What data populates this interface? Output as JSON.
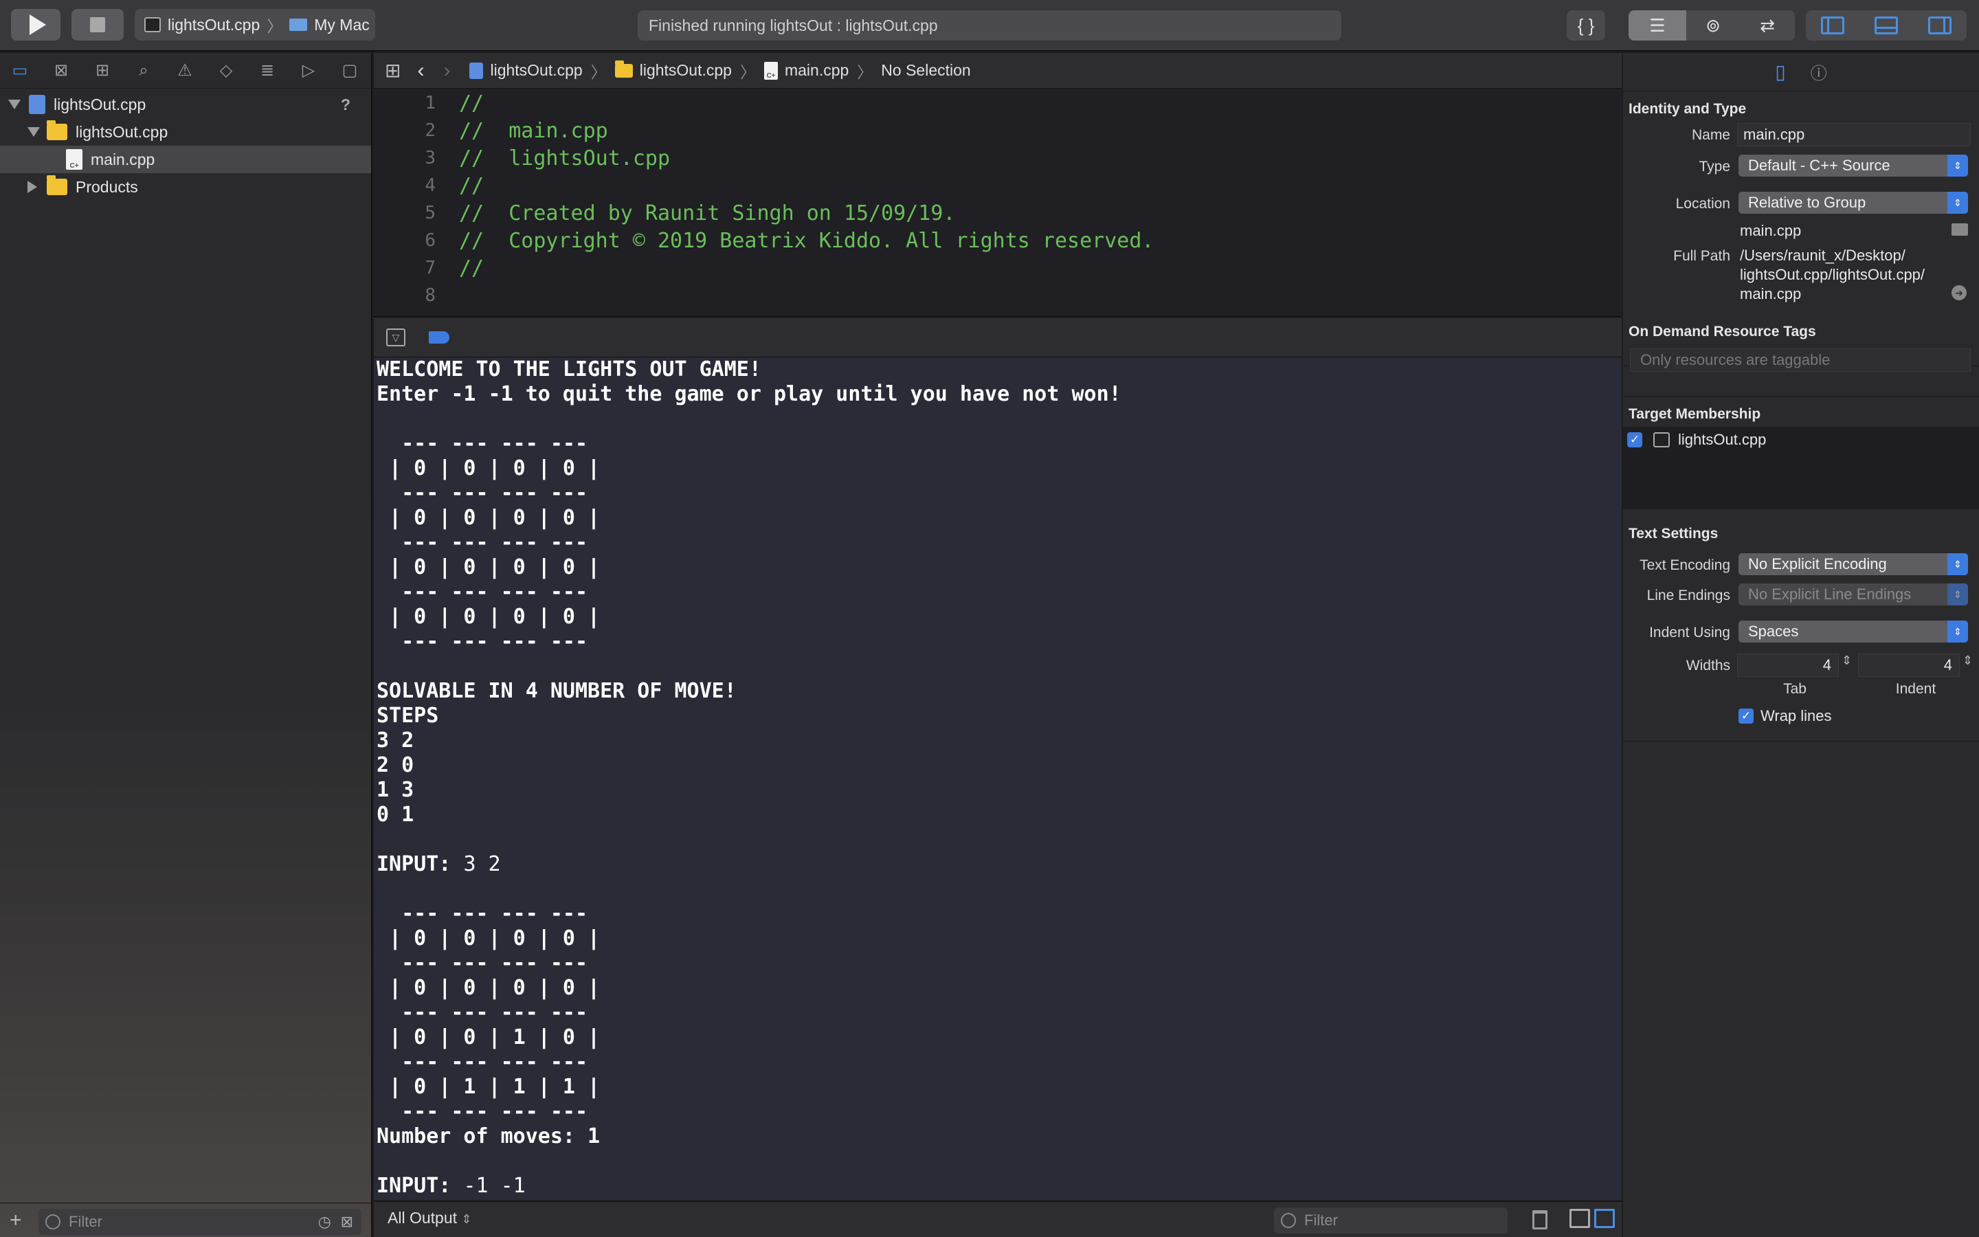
{
  "toolbar": {
    "scheme_target": "lightsOut.cpp",
    "scheme_device": "My Mac",
    "activity": "Finished running lightsOut : lightsOut.cpp",
    "library_icon": "{ }"
  },
  "navigator": {
    "tabs": [
      "folder-icon",
      "source-control-icon",
      "symbol-icon",
      "find-icon",
      "issue-icon",
      "test-icon",
      "debug-icon",
      "breakpoint-icon",
      "report-icon"
    ],
    "items": [
      {
        "label": "lightsOut.cpp",
        "badge": "?"
      },
      {
        "label": "lightsOut.cpp"
      },
      {
        "label": "main.cpp"
      },
      {
        "label": "Products"
      }
    ],
    "filter_placeholder": "Filter"
  },
  "jump_bar": {
    "crumbs": [
      "lightsOut.cpp",
      "lightsOut.cpp",
      "main.cpp",
      "No Selection"
    ]
  },
  "editor": {
    "lines": [
      {
        "n": "1",
        "text": "//"
      },
      {
        "n": "2",
        "text": "//  main.cpp"
      },
      {
        "n": "3",
        "text": "//  lightsOut.cpp"
      },
      {
        "n": "4",
        "text": "//"
      },
      {
        "n": "5",
        "text": "//  Created by Raunit Singh on 15/09/19."
      },
      {
        "n": "6",
        "text": "//  Copyright © 2019 Beatrix Kiddo. All rights reserved."
      },
      {
        "n": "7",
        "text": "//"
      },
      {
        "n": "8",
        "text": ""
      }
    ]
  },
  "console": {
    "lines": [
      {
        "b": "WELCOME TO THE LIGHTS OUT GAME!",
        "p": ""
      },
      {
        "b": "Enter -1 -1 to quit the game or play until you have not won!",
        "p": ""
      },
      {
        "b": "",
        "p": ""
      },
      {
        "b": "  --- --- --- ---",
        "p": ""
      },
      {
        "b": " | 0 | 0 | 0 | 0 |",
        "p": ""
      },
      {
        "b": "  --- --- --- ---",
        "p": ""
      },
      {
        "b": " | 0 | 0 | 0 | 0 |",
        "p": ""
      },
      {
        "b": "  --- --- --- ---",
        "p": ""
      },
      {
        "b": " | 0 | 0 | 0 | 0 |",
        "p": ""
      },
      {
        "b": "  --- --- --- ---",
        "p": ""
      },
      {
        "b": " | 0 | 0 | 0 | 0 |",
        "p": ""
      },
      {
        "b": "  --- --- --- ---",
        "p": ""
      },
      {
        "b": "",
        "p": ""
      },
      {
        "b": "SOLVABLE IN 4 NUMBER OF MOVE!",
        "p": ""
      },
      {
        "b": "STEPS",
        "p": ""
      },
      {
        "b": "3 2",
        "p": ""
      },
      {
        "b": "2 0",
        "p": ""
      },
      {
        "b": "1 3",
        "p": ""
      },
      {
        "b": "0 1",
        "p": ""
      },
      {
        "b": "",
        "p": ""
      },
      {
        "b": "INPUT: ",
        "p": "3 2"
      },
      {
        "b": "",
        "p": ""
      },
      {
        "b": "  --- --- --- ---",
        "p": ""
      },
      {
        "b": " | 0 | 0 | 0 | 0 |",
        "p": ""
      },
      {
        "b": "  --- --- --- ---",
        "p": ""
      },
      {
        "b": " | 0 | 0 | 0 | 0 |",
        "p": ""
      },
      {
        "b": "  --- --- --- ---",
        "p": ""
      },
      {
        "b": " | 0 | 0 | 1 | 0 |",
        "p": ""
      },
      {
        "b": "  --- --- --- ---",
        "p": ""
      },
      {
        "b": " | 0 | 1 | 1 | 1 |",
        "p": ""
      },
      {
        "b": "  --- --- --- ---",
        "p": ""
      },
      {
        "b": "Number of moves: 1",
        "p": ""
      },
      {
        "b": "",
        "p": ""
      },
      {
        "b": "INPUT: ",
        "p": "-1 -1"
      }
    ],
    "output_mode": "All Output",
    "filter_placeholder": "Filter"
  },
  "inspector": {
    "identity": {
      "title": "Identity and Type",
      "name_label": "Name",
      "name_value": "main.cpp",
      "type_label": "Type",
      "type_value": "Default - C++ Source",
      "location_label": "Location",
      "location_value": "Relative to Group",
      "location_file": "main.cpp",
      "fullpath_label": "Full Path",
      "fullpath_lines": [
        "/Users/raunit_x/Desktop/",
        "lightsOut.cpp/lightsOut.cpp/",
        "main.cpp"
      ]
    },
    "tags": {
      "title": "On Demand Resource Tags",
      "placeholder": "Only resources are taggable"
    },
    "membership": {
      "title": "Target Membership",
      "target": "lightsOut.cpp",
      "checked": true
    },
    "text_settings": {
      "title": "Text Settings",
      "encoding_label": "Text Encoding",
      "encoding_value": "No Explicit Encoding",
      "endings_label": "Line Endings",
      "endings_value": "No Explicit Line Endings",
      "indent_label": "Indent Using",
      "indent_value": "Spaces",
      "widths_label": "Widths",
      "tab_value": "4",
      "indent_width_value": "4",
      "tab_caption": "Tab",
      "indent_caption": "Indent",
      "wrap_label": "Wrap lines",
      "wrap_checked": true
    }
  },
  "colors": {
    "accent": "#3d7be0",
    "comment_green": "#6bbf59",
    "console_bg": "#2a2b36"
  }
}
